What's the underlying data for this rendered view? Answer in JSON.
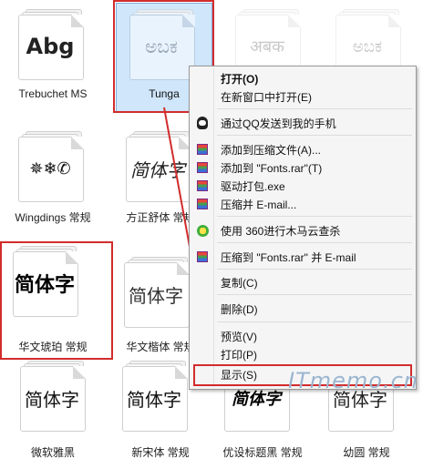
{
  "fonts": [
    {
      "name": "Trebuchet MS",
      "sample": "Abg",
      "faded": false
    },
    {
      "name": "Tunga",
      "sample": "ಅಬಕ",
      "faded": false
    },
    {
      "name": "",
      "sample": "अबक",
      "faded": true
    },
    {
      "name": "",
      "sample": "ಅಬಕ",
      "faded": true
    },
    {
      "name": "Wingdings 常规",
      "sample": "✵❄✆",
      "faded": false
    },
    {
      "name": "方正舒体 常规",
      "sample": "简体字",
      "faded": false
    },
    {
      "name": "华文琥珀 常规",
      "sample": "简体字",
      "faded": false
    },
    {
      "name": "华文楷体 常规",
      "sample": "简体字",
      "faded": false
    },
    {
      "name": "微软雅黑",
      "sample": "简体字",
      "faded": false
    },
    {
      "name": "新宋体 常规",
      "sample": "简体字",
      "faded": false
    },
    {
      "name": "优设标题黑 常规",
      "sample": "简体字",
      "faded": false
    },
    {
      "name": "幼圆 常规",
      "sample": "简体字",
      "faded": false
    }
  ],
  "context_menu": {
    "items": [
      {
        "label": "打开(O)",
        "bold": true,
        "icon": ""
      },
      {
        "label": "在新窗口中打开(E)",
        "icon": ""
      },
      {
        "label": "通过QQ发送到我的手机",
        "icon": "qq-icon"
      },
      {
        "label": "添加到压缩文件(A)...",
        "icon": "winrar-icon"
      },
      {
        "label": "添加到 \"Fonts.rar\"(T)",
        "icon": "winrar-icon"
      },
      {
        "label": "驱动打包.exe",
        "icon": "winrar-icon"
      },
      {
        "label": "压缩并 E-mail...",
        "icon": "winrar-icon"
      },
      {
        "label": "使用 360进行木马云查杀",
        "icon": "360-icon"
      },
      {
        "label": "压缩到 \"Fonts.rar\" 并 E-mail",
        "icon": "winrar-icon"
      },
      {
        "label": "复制(C)",
        "icon": ""
      },
      {
        "label": "删除(D)",
        "icon": ""
      },
      {
        "label": "预览(V)",
        "icon": ""
      },
      {
        "label": "打印(P)",
        "icon": ""
      },
      {
        "label": "显示(S)",
        "icon": ""
      }
    ]
  },
  "watermark": "ITmemo.cn",
  "colors": {
    "highlight_box": "#d22c2c",
    "selection": "#cfe6fb",
    "menu_bg": "#f5f5f5"
  }
}
